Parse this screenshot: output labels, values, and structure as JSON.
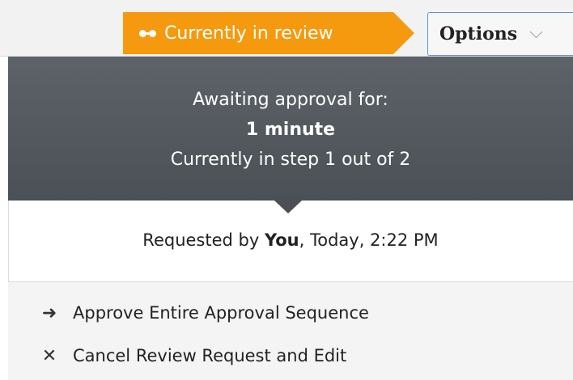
{
  "status_badge": {
    "label": "Currently in review",
    "icon": "glasses-icon",
    "color": "#f59a0e"
  },
  "options_button": {
    "label": "Options",
    "icon": "chevron-down-icon"
  },
  "approval_panel": {
    "awaiting_label": "Awaiting approval for:",
    "duration": "1 minute",
    "step_text": "Currently in step 1 out of 2"
  },
  "request_info": {
    "prefix": "Requested by ",
    "requester": "You",
    "suffix": ", Today, 2:22 PM"
  },
  "actions": [
    {
      "label": "Approve Entire Approval Sequence",
      "icon": "arrow-right-icon"
    },
    {
      "label": "Cancel Review Request and Edit",
      "icon": "x-icon"
    }
  ]
}
